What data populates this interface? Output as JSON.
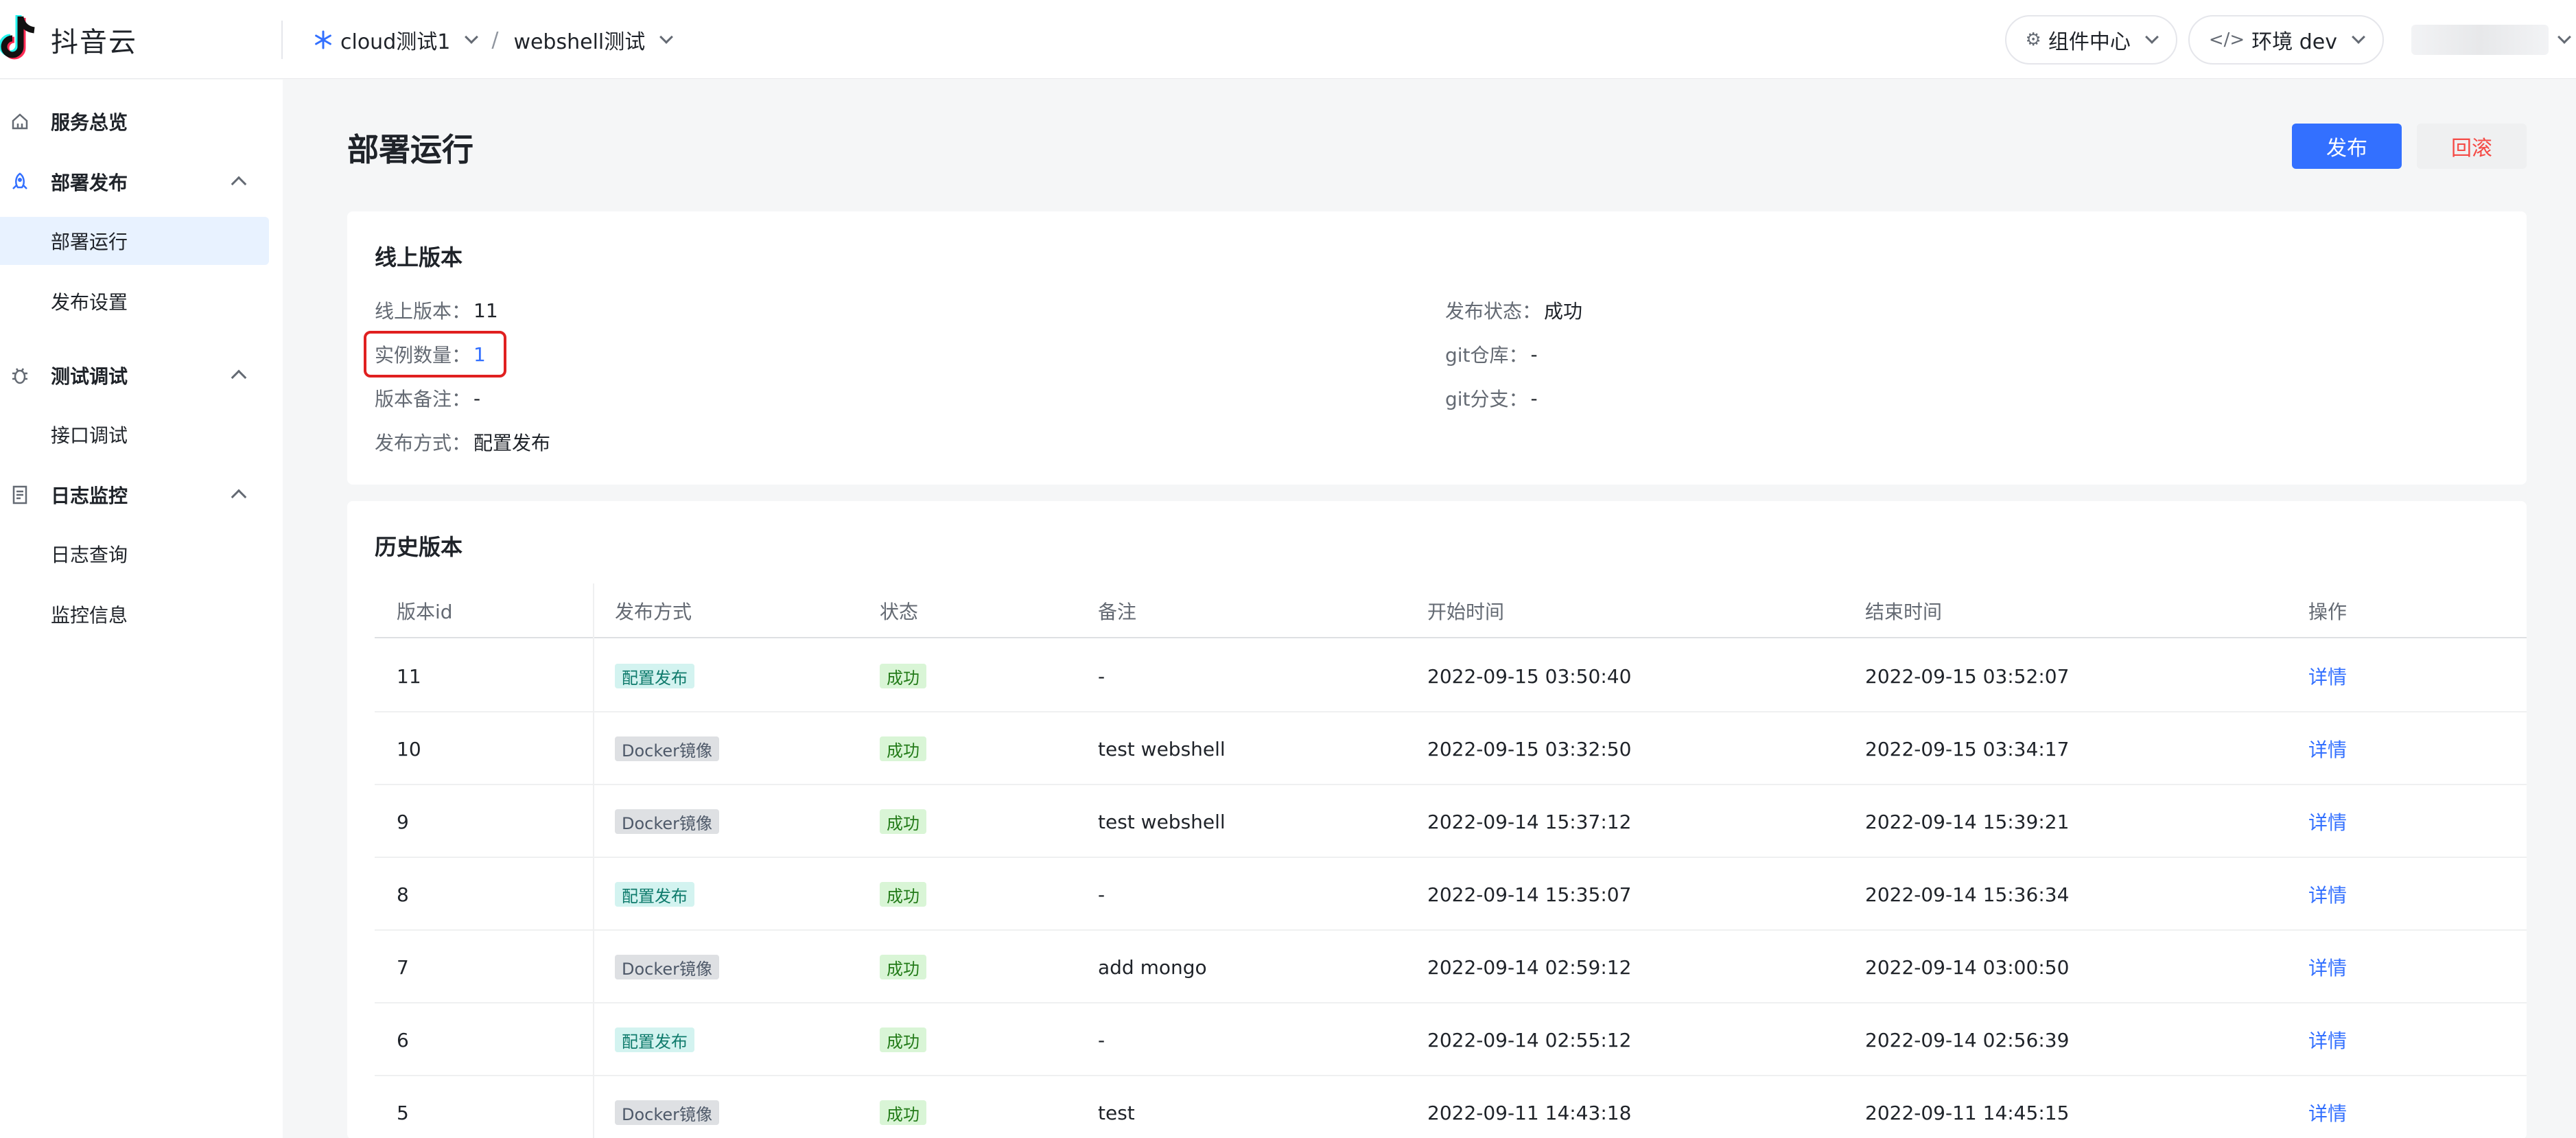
{
  "header": {
    "app_name": "抖音云",
    "crumbs": [
      {
        "label": "cloud测试1"
      },
      {
        "label": "webshell测试"
      }
    ],
    "crumb_separator": "/",
    "component_center": "组件中心",
    "environment": "环境 dev"
  },
  "sidebar": {
    "groups": [
      {
        "label": "服务总览",
        "icon": "home-icon"
      },
      {
        "label": "部署发布",
        "icon": "rocket-icon",
        "items": [
          {
            "label": "部署运行",
            "active": true
          },
          {
            "label": "发布设置"
          }
        ]
      },
      {
        "label": "测试调试",
        "icon": "bug-icon",
        "items": [
          {
            "label": "接口调试"
          }
        ]
      },
      {
        "label": "日志监控",
        "icon": "document-icon",
        "items": [
          {
            "label": "日志查询"
          },
          {
            "label": "监控信息"
          }
        ]
      }
    ]
  },
  "page": {
    "title": "部署运行",
    "publish_button": "发布",
    "rollback_button": "回滚"
  },
  "online": {
    "title": "线上版本",
    "left": [
      {
        "key": "线上版本：",
        "value": "11"
      },
      {
        "key": "实例数量：",
        "value": "1"
      },
      {
        "key": "版本备注：",
        "value": "-"
      },
      {
        "key": "发布方式：",
        "value": "配置发布"
      }
    ],
    "right": [
      {
        "key": "发布状态：",
        "value": "成功"
      },
      {
        "key": "git仓库：",
        "value": "-"
      },
      {
        "key": "git分支：",
        "value": "-"
      }
    ]
  },
  "history": {
    "title": "历史版本",
    "columns": [
      "版本id",
      "发布方式",
      "状态",
      "备注",
      "开始时间",
      "结束时间",
      "操作"
    ],
    "rows": [
      {
        "id": "11",
        "method": "配置发布",
        "method_type": "config",
        "status": "成功",
        "note": "-",
        "start": "2022-09-15 03:50:40",
        "end": "2022-09-15 03:52:07",
        "action": "详情"
      },
      {
        "id": "10",
        "method": "Docker镜像",
        "method_type": "docker",
        "status": "成功",
        "note": "test webshell",
        "start": "2022-09-15 03:32:50",
        "end": "2022-09-15 03:34:17",
        "action": "详情"
      },
      {
        "id": "9",
        "method": "Docker镜像",
        "method_type": "docker",
        "status": "成功",
        "note": "test webshell",
        "start": "2022-09-14 15:37:12",
        "end": "2022-09-14 15:39:21",
        "action": "详情"
      },
      {
        "id": "8",
        "method": "配置发布",
        "method_type": "config",
        "status": "成功",
        "note": "-",
        "start": "2022-09-14 15:35:07",
        "end": "2022-09-14 15:36:34",
        "action": "详情"
      },
      {
        "id": "7",
        "method": "Docker镜像",
        "method_type": "docker",
        "status": "成功",
        "note": "add mongo",
        "start": "2022-09-14 02:59:12",
        "end": "2022-09-14 03:00:50",
        "action": "详情"
      },
      {
        "id": "6",
        "method": "配置发布",
        "method_type": "config",
        "status": "成功",
        "note": "-",
        "start": "2022-09-14 02:55:12",
        "end": "2022-09-14 02:56:39",
        "action": "详情"
      },
      {
        "id": "5",
        "method": "Docker镜像",
        "method_type": "docker",
        "status": "成功",
        "note": "test",
        "start": "2022-09-11 14:43:18",
        "end": "2022-09-11 14:45:15",
        "action": "详情"
      }
    ]
  },
  "colors": {
    "primary": "#3370ff",
    "danger": "#f54a45",
    "highlight": "#e02020",
    "logo_cyan": "#25f4ee",
    "logo_red": "#fe2c55"
  }
}
